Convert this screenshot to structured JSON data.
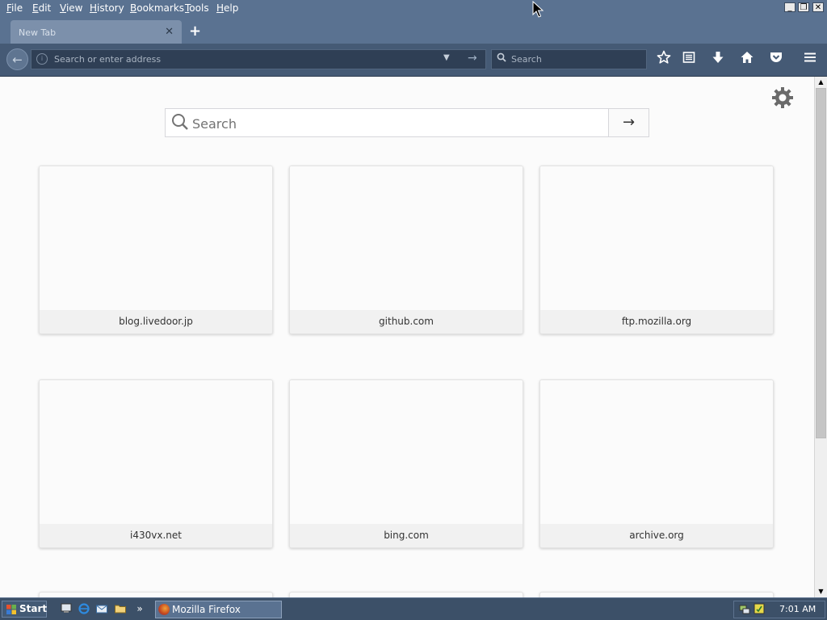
{
  "menubar": {
    "items": [
      {
        "mnemonic": "F",
        "rest": "ile"
      },
      {
        "mnemonic": "E",
        "rest": "dit"
      },
      {
        "mnemonic": "V",
        "rest": "iew"
      },
      {
        "mnemonic": "H",
        "rest": "istory"
      },
      {
        "mnemonic": "B",
        "rest": "ookmarks"
      },
      {
        "mnemonic": "T",
        "rest": "ools"
      },
      {
        "mnemonic": "H",
        "rest": "elp"
      }
    ]
  },
  "window_controls": {
    "minimize": "_",
    "restore": "❐",
    "close": "✕"
  },
  "tabs": [
    {
      "label": "New Tab",
      "close": "✕"
    }
  ],
  "new_tab_symbol": "+",
  "navbar": {
    "back_symbol": "←",
    "info_symbol": "i",
    "address_placeholder": "Search or enter address",
    "dropdown_symbol": "▼",
    "go_symbol": "→",
    "search_placeholder": "Search",
    "toolbar_icons": [
      "star-icon",
      "reading-list-icon",
      "download-icon",
      "home-icon",
      "pocket-icon",
      "menu-icon"
    ]
  },
  "content": {
    "search_placeholder": "Search",
    "go_symbol": "→",
    "settings_icon": "gear-icon",
    "tiles": [
      {
        "title": "blog.livedoor.jp"
      },
      {
        "title": "github.com"
      },
      {
        "title": "ftp.mozilla.org"
      },
      {
        "title": "i430vx.net"
      },
      {
        "title": "bing.com"
      },
      {
        "title": "archive.org"
      }
    ]
  },
  "taskbar": {
    "start_label": "Start",
    "task_label": "Mozilla Firefox",
    "overflow_symbol": "»",
    "clock": "7:01 AM"
  },
  "colors": {
    "chrome": "#5a7291",
    "navbar": "#455a75",
    "content_bg": "#fbfbfb",
    "taskbar": "#3c5068"
  }
}
